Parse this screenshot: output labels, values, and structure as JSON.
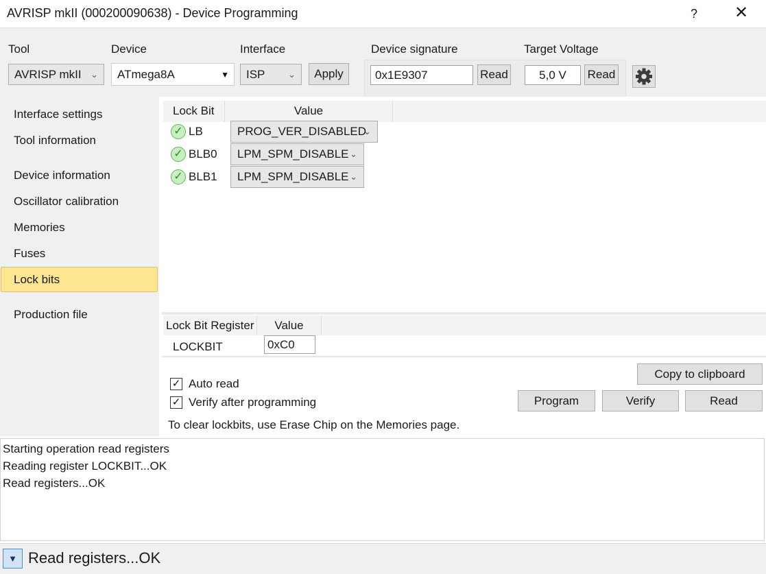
{
  "window": {
    "title": "AVRISP mkII (000200090638) - Device Programming",
    "help_label": "?",
    "close_label": "✕"
  },
  "toolbar": {
    "tool_label": "Tool",
    "tool_value": "AVRISP mkII",
    "device_label": "Device",
    "device_value": "ATmega8A",
    "interface_label": "Interface",
    "interface_value": "ISP",
    "apply_label": "Apply",
    "signature_label": "Device signature",
    "signature_value": "0x1E9307",
    "signature_read_label": "Read",
    "voltage_label": "Target Voltage",
    "voltage_value": "5,0 V",
    "voltage_read_label": "Read",
    "settings_icon": "gear-icon"
  },
  "sidebar": {
    "items": [
      {
        "label": "Interface settings"
      },
      {
        "label": "Tool information"
      },
      {
        "label": "Device information"
      },
      {
        "label": "Oscillator calibration"
      },
      {
        "label": "Memories"
      },
      {
        "label": "Fuses"
      },
      {
        "label": "Lock bits"
      },
      {
        "label": "Production file"
      }
    ],
    "active_index": 6,
    "active_color": "#fde68f"
  },
  "lockbits": {
    "headers": {
      "bit": "Lock Bit",
      "value": "Value"
    },
    "rows": [
      {
        "name": "LB",
        "value": "PROG_VER_DISABLED"
      },
      {
        "name": "BLB0",
        "value": "LPM_SPM_DISABLE"
      },
      {
        "name": "BLB1",
        "value": "LPM_SPM_DISABLE"
      }
    ],
    "status_icon": "check-circle-icon"
  },
  "register": {
    "headers": {
      "register": "Lock Bit Register",
      "value": "Value"
    },
    "name": "LOCKBIT",
    "value": "0xC0"
  },
  "options": {
    "auto_read_label": "Auto read",
    "auto_read_checked": true,
    "verify_label": "Verify after programming",
    "verify_checked": true,
    "hint": "To clear lockbits, use Erase Chip on the Memories page."
  },
  "actions": {
    "copy_label": "Copy to clipboard",
    "program_label": "Program",
    "verify_label": "Verify",
    "read_label": "Read"
  },
  "log": {
    "lines": [
      "Starting operation read registers",
      "Reading register LOCKBIT...OK",
      "Read registers...OK"
    ]
  },
  "status": {
    "text": "Read registers...OK",
    "expand_icon": "triangle-down-icon"
  }
}
